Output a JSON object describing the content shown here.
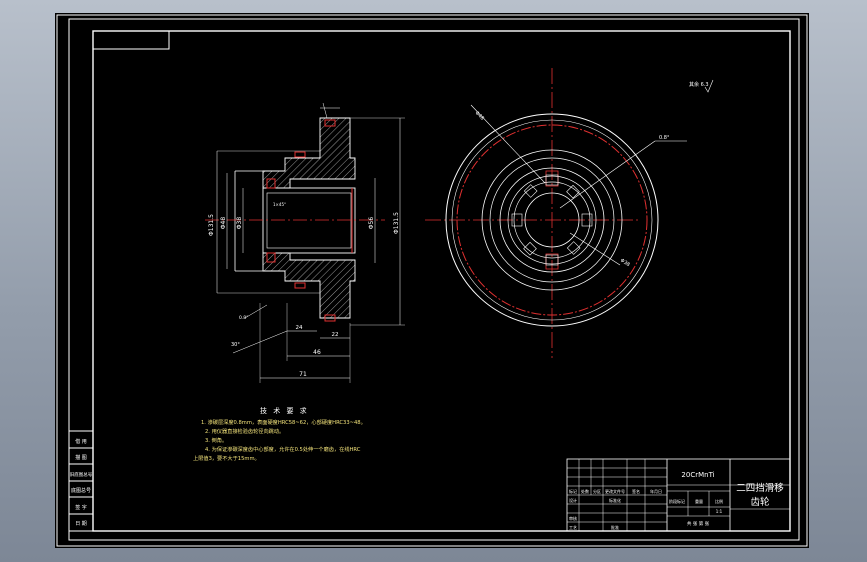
{
  "tech_requirements": {
    "title": "技 术 要 求",
    "lines": [
      "1. 渗碳层深度0.8mm，表面硬度HRC58~62，心部硬度HRC33~48。",
      "2. 用仪器直接检验齿轮径向跳动。",
      "3. 倒角。",
      "4. 为保证渗碳深度齿中心部度，允许在0.5处伸一个磨齿，在线HRC",
      "上限值3，要不大于15mm。"
    ]
  },
  "surface_note": "其余 6.3",
  "title_block": {
    "material": "20CrMnTi",
    "part_name_line1": "二四挡滑移",
    "part_name_line2": "齿轮",
    "left_labels": [
      "标记",
      "处数",
      "分区",
      "更改文件号",
      "签名",
      "年月日"
    ],
    "row_labels": [
      "设计",
      "审核",
      "工艺"
    ],
    "std_label": "标准化",
    "approve_label": "批准",
    "stage_label": "阶段标记",
    "weight_label": "重量",
    "scale_label": "比例",
    "scale_value": "1:1",
    "sheet_label": "共 张 第 张"
  },
  "side_labels": [
    "借 用",
    "描 图",
    "旧底图总号",
    "底图总号",
    "签 字",
    "日 期"
  ],
  "dimensions": {
    "d1": "Φ131.5",
    "d2": "Φ48",
    "d3": "Φ38",
    "d4": "Φ56",
    "d5": "Φ131.5",
    "l1": "71",
    "l2": "46",
    "l3": "22",
    "l4": "24",
    "chamfer": "1×45°",
    "angle": "30°",
    "note_r": "0.8°"
  }
}
